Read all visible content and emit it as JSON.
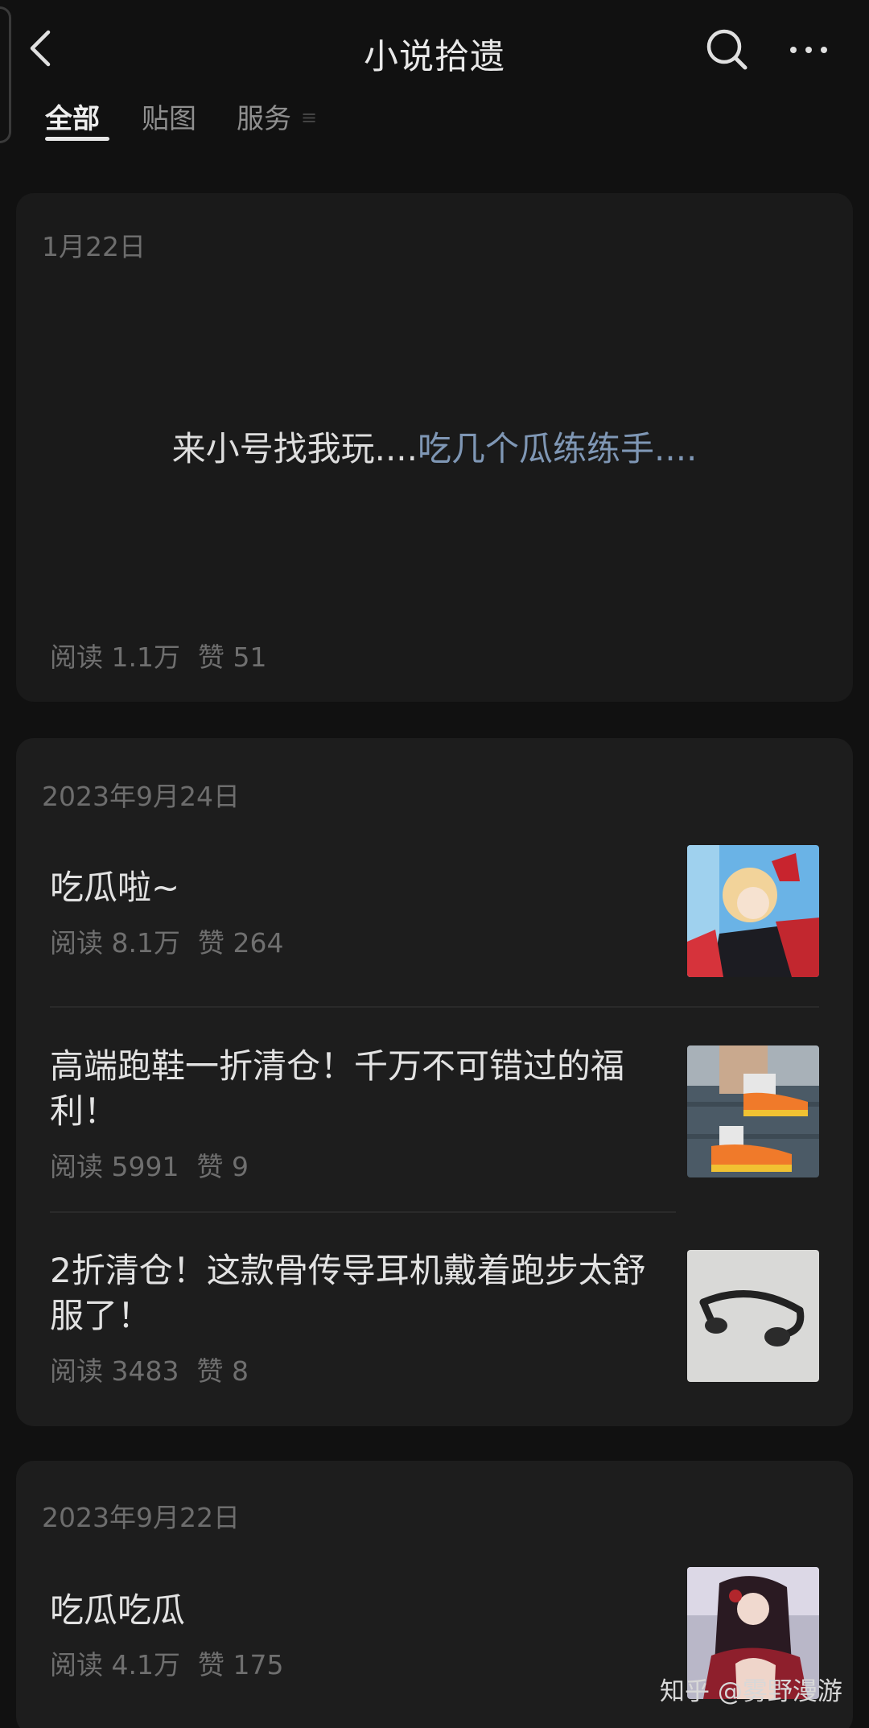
{
  "header": {
    "title": "小说拾遗",
    "back_icon": "chevron-left-icon",
    "search_icon": "search-icon",
    "more_icon": "more-horizontal-icon"
  },
  "tabs": [
    {
      "label": "全部",
      "active": true
    },
    {
      "label": "贴图",
      "active": false
    },
    {
      "label": "服务",
      "active": false
    }
  ],
  "cards": [
    {
      "date": "1月22日",
      "text_plain": "来小号找我玩....",
      "text_highlight": "吃几个瓜练练手....",
      "reads": "阅读 1.1万",
      "likes": "赞 51"
    },
    {
      "date": "2023年9月24日",
      "posts": [
        {
          "title": "吃瓜啦~",
          "reads": "阅读 8.1万",
          "likes": "赞 264",
          "thumb": "anime-girl-image"
        },
        {
          "title": "高端跑鞋一折清仓！千万不可错过的福利！",
          "reads": "阅读 5991",
          "likes": "赞 9",
          "thumb": "running-shoes-image"
        },
        {
          "title": "2折清仓！这款骨传导耳机戴着跑步太舒服了！",
          "reads": "阅读 3483",
          "likes": "赞 8",
          "thumb": "headphones-image"
        }
      ]
    },
    {
      "date": "2023年9月22日",
      "posts": [
        {
          "title": "吃瓜吃瓜",
          "reads": "阅读 4.1万",
          "likes": "赞 175",
          "thumb": "anime-character-image"
        }
      ]
    }
  ],
  "watermark": "知乎 @雾野漫游",
  "colors": {
    "background": "#111111",
    "card": "#1d1d1d",
    "highlight": "#7f97b5"
  }
}
